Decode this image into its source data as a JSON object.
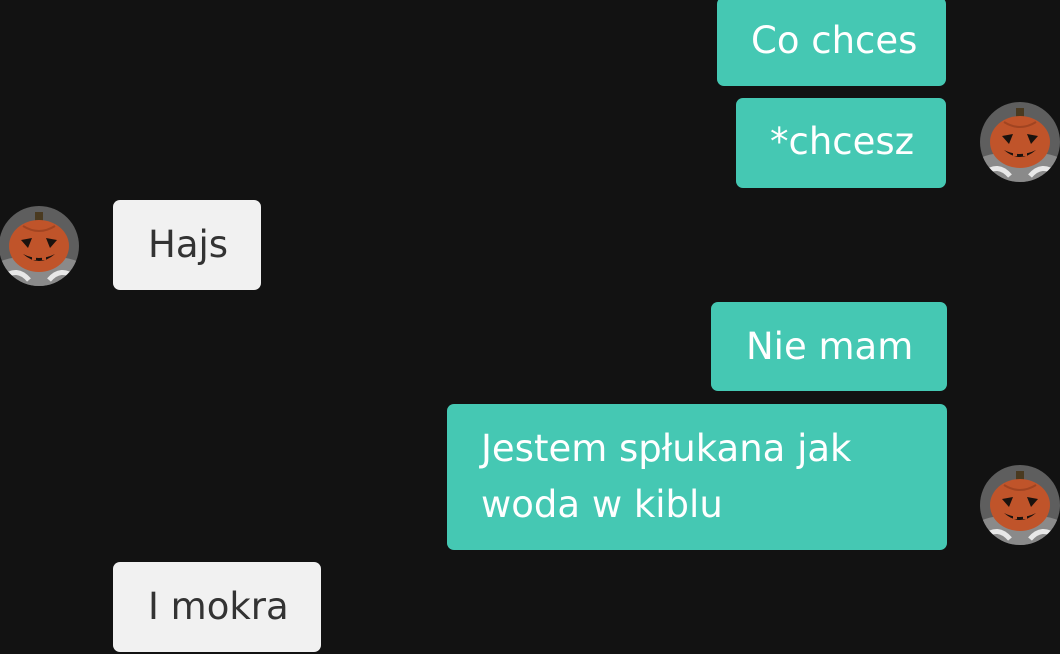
{
  "conversation": {
    "messages": [
      {
        "sender": "me",
        "text": "Co chces"
      },
      {
        "sender": "me",
        "text": "*chcesz"
      },
      {
        "sender": "them",
        "text": "Hajs"
      },
      {
        "sender": "me",
        "text": "Nie mam"
      },
      {
        "sender": "me",
        "text": "Jestem spłukana jak woda w kiblu"
      },
      {
        "sender": "them",
        "text": "I mokra"
      }
    ]
  },
  "avatar": {
    "icon": "pumpkin-icon",
    "colors": {
      "face": "#c0542a",
      "features": "#1a120e",
      "ring": "#6e6e6e"
    }
  },
  "colors": {
    "background": "#121212",
    "outgoing_bubble": "#45c8b3",
    "incoming_bubble": "#f1f1f1"
  }
}
